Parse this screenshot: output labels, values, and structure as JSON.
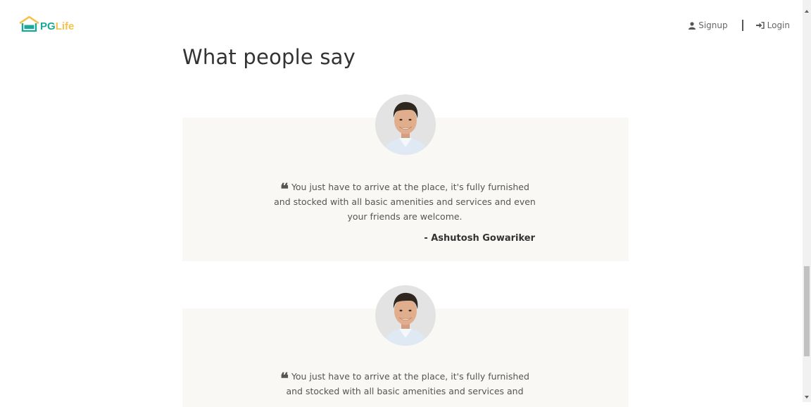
{
  "brand": {
    "pg": "PG",
    "life": "Life"
  },
  "nav": {
    "signup_label": "Signup",
    "login_label": "Login"
  },
  "section": {
    "title": "What people say"
  },
  "testimonials": [
    {
      "quote_mark": "❝",
      "text": "You just have to arrive at the place, it's fully furnished and stocked with all basic amenities and services and even your friends are welcome.",
      "author": "- Ashutosh Gowariker"
    },
    {
      "quote_mark": "❝",
      "text": "You just have to arrive at the place, it's fully furnished and stocked with all basic amenities and services and"
    }
  ],
  "colors": {
    "brand_teal": "#1aa89b",
    "brand_yellow": "#f3c34c",
    "card_bg": "#faf8f5"
  },
  "icons": [
    "house-logo-icon",
    "user-icon",
    "sign-in-icon",
    "quote-icon"
  ]
}
